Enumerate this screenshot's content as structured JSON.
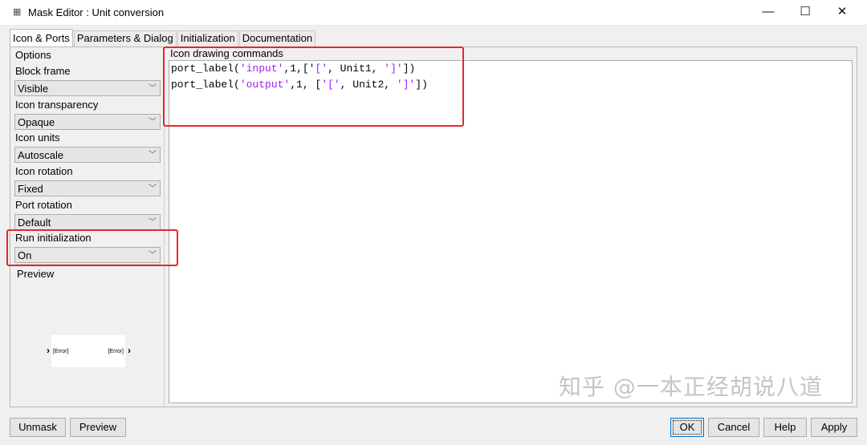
{
  "window": {
    "title": "Mask Editor : Unit conversion",
    "app_icon": "mask-editor-icon",
    "controls": {
      "minimize": "—",
      "maximize": "☐",
      "close": "✕"
    }
  },
  "tabs": [
    {
      "label": "Icon & Ports",
      "active": true
    },
    {
      "label": "Parameters & Dialog",
      "active": false
    },
    {
      "label": "Initialization",
      "active": false
    },
    {
      "label": "Documentation",
      "active": false
    }
  ],
  "options": {
    "header": "Options",
    "block_frame": {
      "label": "Block frame",
      "value": "Visible"
    },
    "icon_transparency": {
      "label": "Icon transparency",
      "value": "Opaque"
    },
    "icon_units": {
      "label": "Icon units",
      "value": "Autoscale"
    },
    "icon_rotation": {
      "label": "Icon rotation",
      "value": "Fixed"
    },
    "port_rotation": {
      "label": "Port rotation",
      "value": "Default"
    },
    "run_initialization": {
      "label": "Run initialization",
      "value": "On"
    }
  },
  "preview": {
    "label": "Preview",
    "left_port_text": "[Error]",
    "right_port_text": "[Error]"
  },
  "commands": {
    "label": "Icon drawing commands",
    "lines": [
      {
        "pre": "port_label(",
        "s1": "'input'",
        "mid": ",1,['",
        "s2": "['",
        "mid2": ", Unit1, ",
        "s3": "']'",
        "post": "])"
      },
      {
        "pre": "port_label(",
        "s1": "'output'",
        "mid": ",1, [",
        "s2": "'['",
        "mid2": ", Unit2, ",
        "s3": "']'",
        "post": "])"
      }
    ]
  },
  "buttons": {
    "unmask": "Unmask",
    "preview": "Preview",
    "ok": "OK",
    "cancel": "Cancel",
    "help": "Help",
    "apply": "Apply"
  },
  "watermark": "知乎 @一本正经胡说八道",
  "colors": {
    "highlight": "#e8262a",
    "string": "#a020f0"
  }
}
